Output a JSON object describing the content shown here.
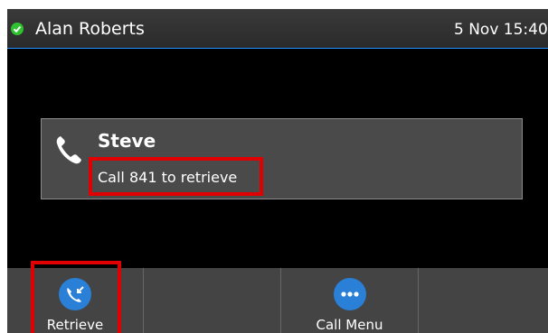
{
  "status_bar": {
    "user_name": "Alan Roberts",
    "datetime": "5 Nov 15:40",
    "presence_icon": "check-circle-icon",
    "presence_color": "#2fc12f"
  },
  "call": {
    "caller_name": "Steve",
    "retrieve_message": "Call 841 to retrieve",
    "icon": "phone-icon"
  },
  "softkeys": [
    {
      "label": "Retrieve",
      "icon": "retrieve-call-icon"
    },
    {
      "label": ""
    },
    {
      "label": "Call Menu",
      "icon": "more-dots-icon"
    },
    {
      "label": ""
    }
  ],
  "colors": {
    "accent_blue": "#2a7fd6",
    "highlight_red": "#e00000"
  }
}
